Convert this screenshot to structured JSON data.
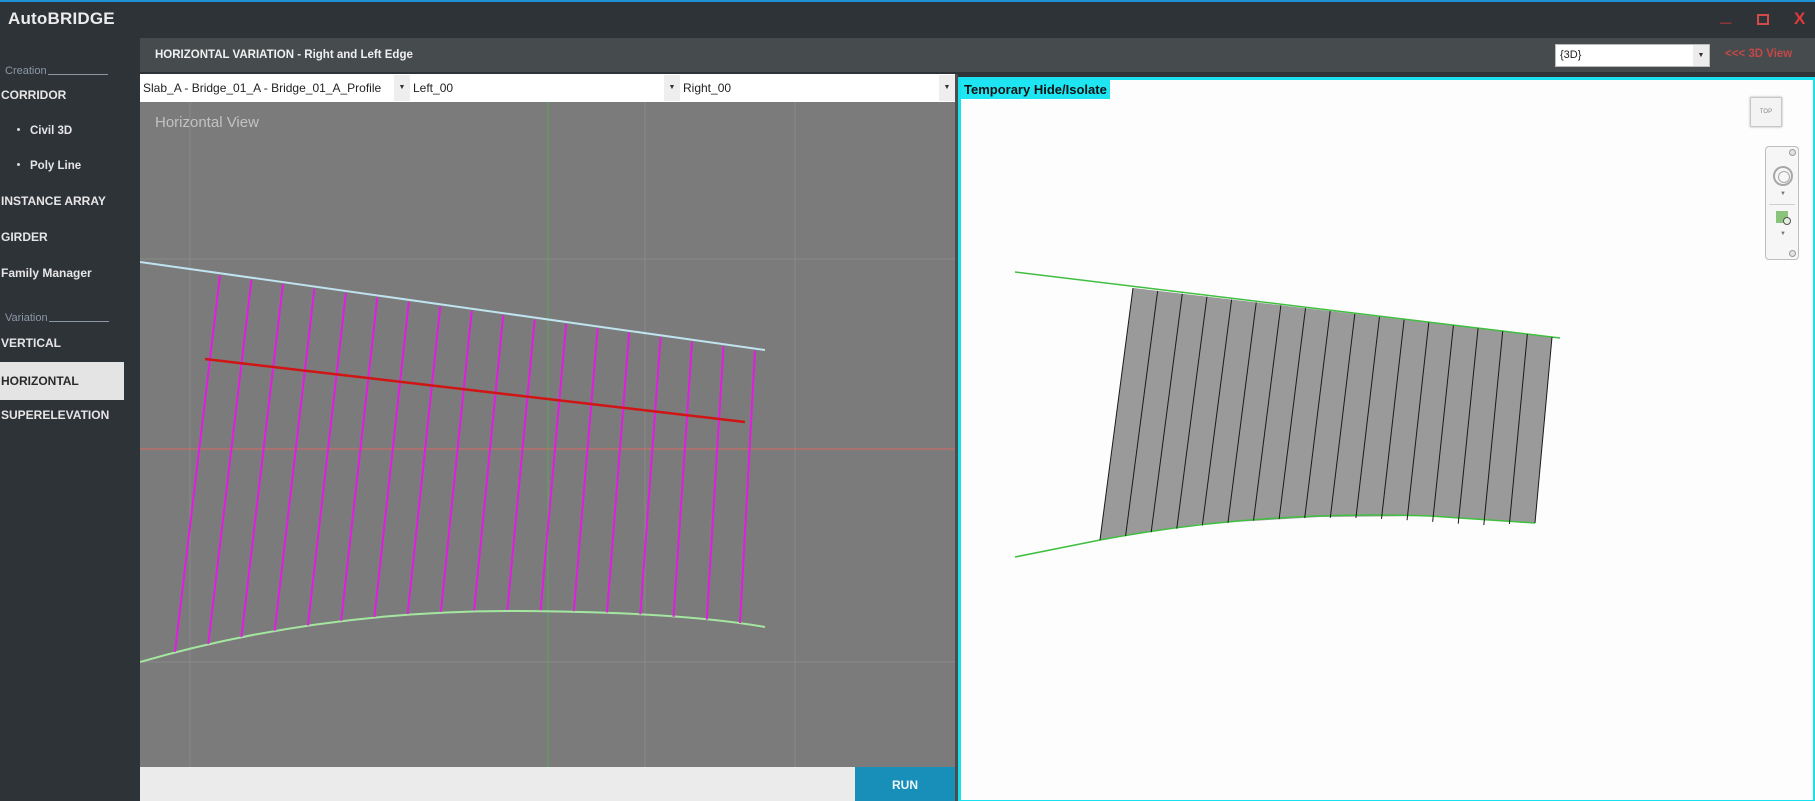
{
  "app": {
    "title": "AutoBRIDGE",
    "window_controls": {
      "minimize": "_",
      "maximize": "□",
      "close": "X"
    }
  },
  "sidebar": {
    "sections": [
      {
        "label": "Creation"
      },
      {
        "label": "Variation"
      }
    ],
    "items": [
      {
        "label": "CORRIDOR",
        "type": "item"
      },
      {
        "label": "Civil 3D",
        "type": "sub"
      },
      {
        "label": "Poly Line",
        "type": "sub"
      },
      {
        "label": "INSTANCE ARRAY",
        "type": "item"
      },
      {
        "label": "GIRDER",
        "type": "item"
      },
      {
        "label": "Family Manager",
        "type": "item"
      },
      {
        "label": "VERTICAL",
        "type": "item"
      },
      {
        "label": "HORIZONTAL",
        "type": "item",
        "active": true
      },
      {
        "label": "SUPERELEVATION",
        "type": "item"
      }
    ]
  },
  "header": {
    "title": "HORIZONTAL VARIATION - Right and Left Edge",
    "view_select": {
      "value": "{3D}"
    },
    "view_link": "<<< 3D View"
  },
  "combos": {
    "profile": "Slab_A - Bridge_01_A - Bridge_01_A_Profile",
    "left_edge": "Left_00",
    "right_edge": "Right_00"
  },
  "horizontal_view": {
    "label": "Horizontal View",
    "colors": {
      "background": "#7b7b7b",
      "grid": "#8a8a8a",
      "axis_x": "#d76a63",
      "axis_y": "#5aa858",
      "right_edge": "#bfe3ef",
      "left_edge": "#a4e6a0",
      "centerline": "#d11414",
      "section_lines": "#e31be3"
    },
    "section_count": 18
  },
  "footer": {
    "run_label": "RUN"
  },
  "view3d": {
    "tag": "Temporary Hide/Isolate",
    "viewcube_label": "TOP",
    "colors": {
      "slab_fill": "#9a9a9a",
      "edge": "#3fbf3f",
      "segment_lines": "#1a1a1a",
      "border": "#19e0ef"
    },
    "segment_count": 17
  }
}
